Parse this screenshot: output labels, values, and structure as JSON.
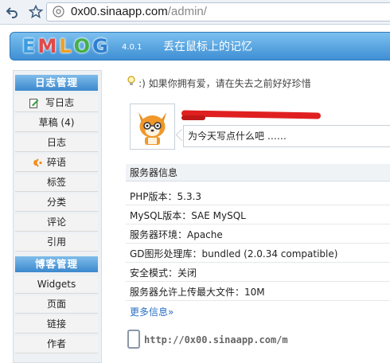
{
  "browser": {
    "url_host": "0x00.sinaapp.com",
    "url_path": "/admin/"
  },
  "header": {
    "logo_letters": [
      "E",
      "M",
      "L",
      "O",
      "G"
    ],
    "version": "4.0.1",
    "motto": "丢在鼠标上的记忆"
  },
  "sidebar": {
    "sections": [
      {
        "title": "日志管理",
        "items": [
          "写日志",
          "草稿 (4)",
          "日志",
          "碎语",
          "标签",
          "分类",
          "评论",
          "引用"
        ]
      },
      {
        "title": "博客管理",
        "items": [
          "Widgets",
          "页面",
          "链接",
          "作者"
        ]
      }
    ]
  },
  "main": {
    "tip": ":) 如果你拥有爱，请在失去之前好好珍惜",
    "post_placeholder": "为今天写点什么吧 ……",
    "server_info": {
      "title": "服务器信息",
      "rows": [
        "PHP版本：5.3.3",
        "MySQL版本：SAE MySQL",
        "服务器环境：Apache",
        "GD图形处理库：bundled (2.0.34 compatible)",
        "安全模式：关闭",
        "服务器允许上传最大文件：10M"
      ],
      "more_link": "更多信息»"
    },
    "mobile_url": "http://0x00.sinaapp.com/m"
  },
  "colors": {
    "accent": "#3e8fd4",
    "link": "#2a6fc4"
  }
}
